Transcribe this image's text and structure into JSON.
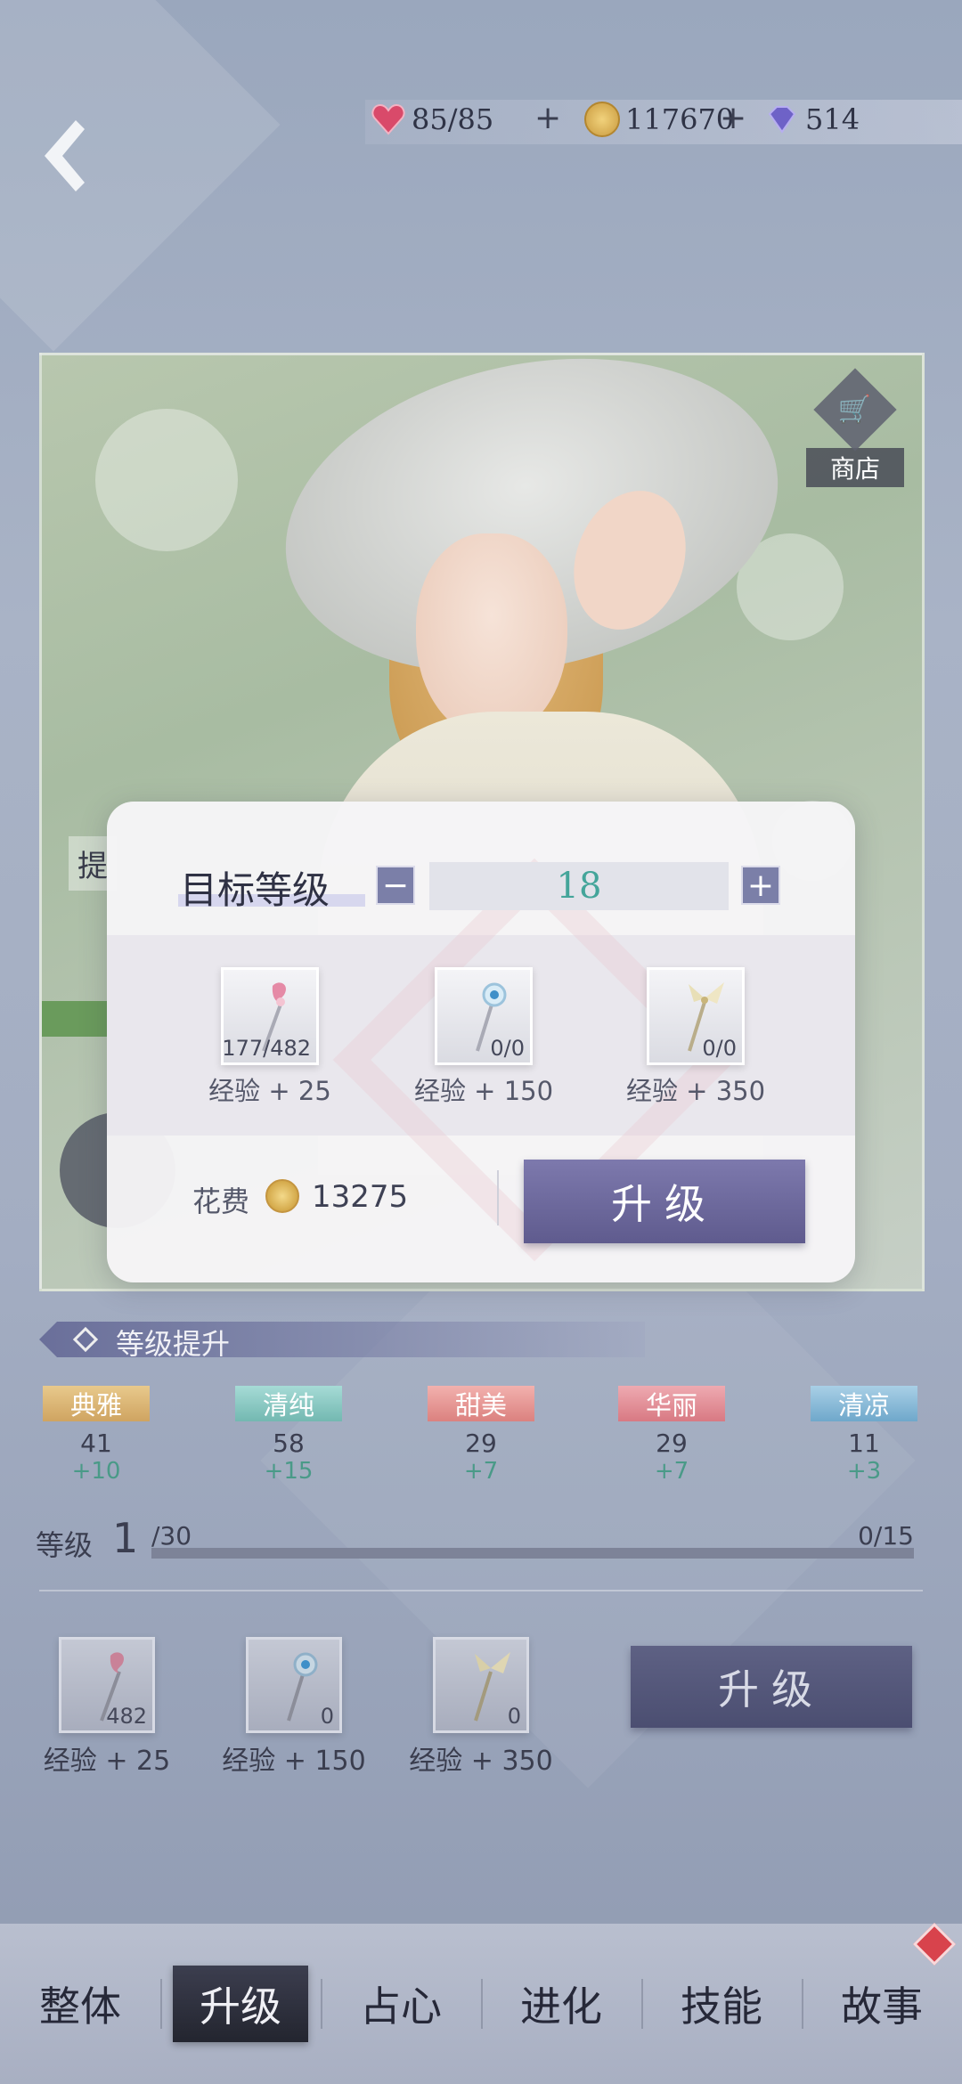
{
  "resources": {
    "stamina": "85/85",
    "gold": "117670",
    "gems": "514",
    "plus_symbol": "+"
  },
  "shop": {
    "label": "商店",
    "icon": "cart-icon"
  },
  "dialog": {
    "target_level_label": "目标等级",
    "minus": "−",
    "plus": "+",
    "target_level": "18",
    "items": [
      {
        "count": "177/482",
        "exp": "经验 + 25",
        "icon": "pink-wand-icon"
      },
      {
        "count": "0/0",
        "exp": "经验 + 150",
        "icon": "blue-wand-icon"
      },
      {
        "count": "0/0",
        "exp": "经验 + 350",
        "icon": "butterfly-wand-icon"
      }
    ],
    "cost_label": "花费",
    "cost_value": "13275",
    "upgrade_label": "升级"
  },
  "section": {
    "title": "等级提升"
  },
  "attributes": [
    {
      "name": "典雅",
      "value": "41",
      "bonus": "+10",
      "color": "#d9b77a"
    },
    {
      "name": "清纯",
      "value": "58",
      "bonus": "+15",
      "color": "#7fc2bd"
    },
    {
      "name": "甜美",
      "value": "29",
      "bonus": "+7",
      "color": "#e58f8e"
    },
    {
      "name": "华丽",
      "value": "29",
      "bonus": "+7",
      "color": "#e08a92"
    },
    {
      "name": "清凉",
      "value": "11",
      "bonus": "+3",
      "color": "#7fb3d3"
    }
  ],
  "level": {
    "label": "等级",
    "current": "1",
    "max": "/30",
    "exp": "0/15",
    "progress": 0
  },
  "lower_items": [
    {
      "count": "482",
      "exp": "经验 + 25"
    },
    {
      "count": "0",
      "exp": "经验 + 150"
    },
    {
      "count": "0",
      "exp": "经验 + 350"
    }
  ],
  "lower_upgrade_label": "升级",
  "tabs": [
    {
      "label": "整体",
      "active": false
    },
    {
      "label": "升级",
      "active": true
    },
    {
      "label": "占心",
      "active": false
    },
    {
      "label": "进化",
      "active": false
    },
    {
      "label": "技能",
      "active": false
    },
    {
      "label": "故事",
      "active": false
    }
  ],
  "portrait_overlay_text": "提"
}
